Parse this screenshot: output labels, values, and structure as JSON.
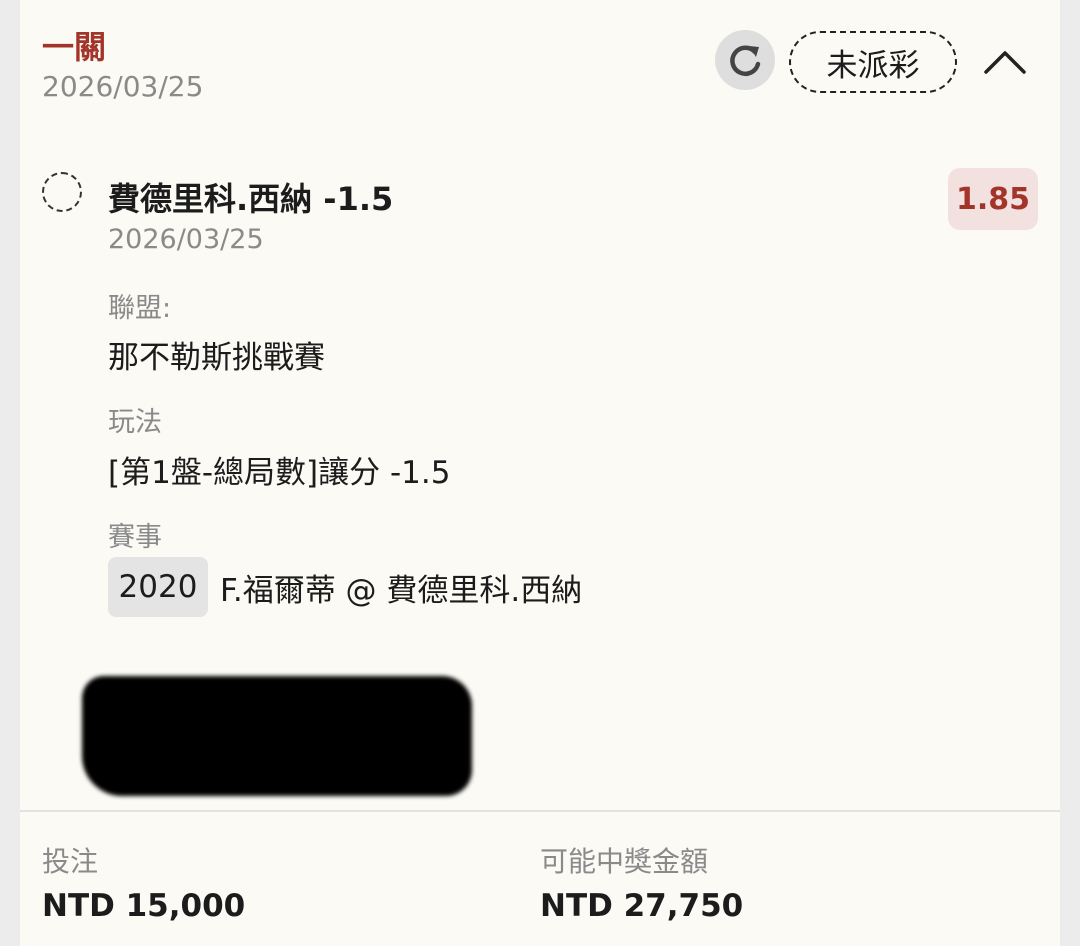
{
  "header": {
    "title": "一關",
    "date": "2026/03/25",
    "status": "未派彩",
    "refresh_icon": "refresh-icon",
    "collapse_icon": "chevron-up-icon"
  },
  "selection": {
    "name": "費德里科.西納 -1.5",
    "date": "2026/03/25",
    "odds": "1.85"
  },
  "details": {
    "league_label": "聯盟:",
    "league_value": "那不勒斯挑戰賽",
    "market_label": "玩法",
    "market_value": "[第1盤-總局數]讓分 -1.5",
    "event_label": "賽事",
    "event_number": "2020",
    "event_name": "F.福爾蒂 @ 費德里科.西納"
  },
  "footer": {
    "stake_label": "投注",
    "stake_value": "NTD 15,000",
    "payout_label": "可能中獎金額",
    "payout_value": "NTD 27,750"
  },
  "colors": {
    "accent": "#a3342a",
    "odds_bg": "#f3e1df",
    "card_bg": "#fbfaf5",
    "muted_text": "#8a8a8a"
  }
}
